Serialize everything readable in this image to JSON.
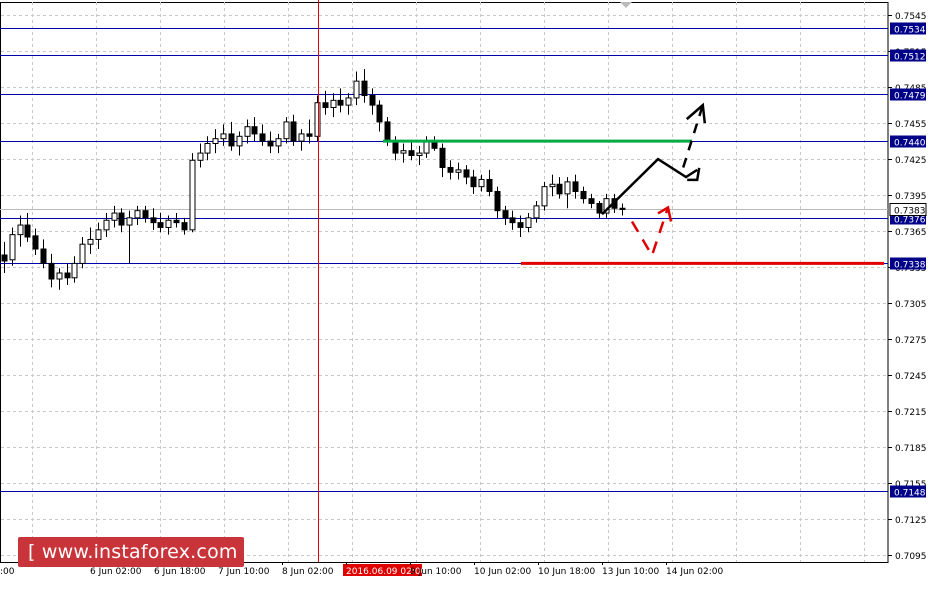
{
  "chart_data": {
    "type": "candlestick",
    "symbol_context": "Forex price chart",
    "price_axis": {
      "ylim": [
        0.7095,
        0.756
      ],
      "tick_labels": [
        "0.7545",
        "0.7515",
        "0.7485",
        "0.7455",
        "0.7425",
        "0.7395",
        "0.7365",
        "0.7335",
        "0.7305",
        "0.7275",
        "0.7245",
        "0.7215",
        "0.7185",
        "0.7155",
        "0.7125",
        "0.7095"
      ],
      "current_price": "0.7383"
    },
    "time_axis": {
      "labels": [
        ":00",
        "6 Jun 02:00",
        "6 Jun 18:00",
        "7 Jun 10:00",
        "8 Jun 02:00",
        "2016.06.09 02:00",
        "9 Jun 10:00",
        "10 Jun 02:00",
        "10 Jun 18:00",
        "13 Jun 10:00",
        "14 Jun 02:00"
      ],
      "highlighted_label": "2016.06.09 02:00"
    },
    "levels": [
      {
        "label": "0.7534",
        "value": 0.7534
      },
      {
        "label": "0.7512",
        "value": 0.7512
      },
      {
        "label": "0.7479",
        "value": 0.7479
      },
      {
        "label": "0.7440",
        "value": 0.744
      },
      {
        "label": "0.7376",
        "value": 0.7376
      },
      {
        "label": "0.7338",
        "value": 0.7338
      },
      {
        "label": "0.7148",
        "value": 0.7148
      }
    ],
    "colors": {
      "level_line": "#0000aa",
      "level_label_bg": "#000088",
      "crosshair": "#e00000",
      "support": "#e00000",
      "resistance": "#00aa44",
      "forecast_up": "#000000",
      "forecast_alt": "#e00000",
      "grid": "#c8c8c8",
      "candle": "#000000"
    },
    "support_level": 0.7338,
    "resistance_level": 0.744,
    "candles": [
      [
        0.7345,
        0.7356,
        0.733,
        0.734
      ],
      [
        0.7341,
        0.7368,
        0.7336,
        0.7362
      ],
      [
        0.7362,
        0.7378,
        0.7352,
        0.737
      ],
      [
        0.737,
        0.738,
        0.7356,
        0.736
      ],
      [
        0.7361,
        0.7367,
        0.7345,
        0.735
      ],
      [
        0.735,
        0.7358,
        0.7334,
        0.7338
      ],
      [
        0.7338,
        0.7346,
        0.7318,
        0.7325
      ],
      [
        0.7325,
        0.7334,
        0.7316,
        0.733
      ],
      [
        0.733,
        0.7338,
        0.732,
        0.7326
      ],
      [
        0.7326,
        0.7344,
        0.7322,
        0.7338
      ],
      [
        0.7338,
        0.736,
        0.7334,
        0.7354
      ],
      [
        0.7354,
        0.7368,
        0.7346,
        0.7358
      ],
      [
        0.7358,
        0.7372,
        0.735,
        0.7366
      ],
      [
        0.7366,
        0.738,
        0.736,
        0.7374
      ],
      [
        0.7374,
        0.7386,
        0.7368,
        0.738
      ],
      [
        0.738,
        0.7384,
        0.7364,
        0.737
      ],
      [
        0.737,
        0.7382,
        0.7338,
        0.7376
      ],
      [
        0.7376,
        0.7386,
        0.737,
        0.7382
      ],
      [
        0.7382,
        0.7386,
        0.7372,
        0.7376
      ],
      [
        0.7376,
        0.7384,
        0.7366,
        0.7372
      ],
      [
        0.7372,
        0.738,
        0.7364,
        0.7368
      ],
      [
        0.7368,
        0.7378,
        0.7362,
        0.7374
      ],
      [
        0.7374,
        0.738,
        0.7368,
        0.7372
      ],
      [
        0.7372,
        0.7376,
        0.7362,
        0.7366
      ],
      [
        0.7366,
        0.743,
        0.7364,
        0.7424
      ],
      [
        0.7424,
        0.7438,
        0.7418,
        0.743
      ],
      [
        0.743,
        0.7444,
        0.7424,
        0.7438
      ],
      [
        0.7438,
        0.745,
        0.743,
        0.7442
      ],
      [
        0.7442,
        0.7454,
        0.7436,
        0.7446
      ],
      [
        0.7446,
        0.7456,
        0.7432,
        0.7436
      ],
      [
        0.7436,
        0.7448,
        0.7428,
        0.7444
      ],
      [
        0.7444,
        0.7458,
        0.7438,
        0.7452
      ],
      [
        0.7452,
        0.746,
        0.744,
        0.7446
      ],
      [
        0.7446,
        0.7454,
        0.7436,
        0.744
      ],
      [
        0.744,
        0.7448,
        0.743,
        0.7436
      ],
      [
        0.7436,
        0.7446,
        0.743,
        0.7442
      ],
      [
        0.7442,
        0.746,
        0.7438,
        0.7456
      ],
      [
        0.7456,
        0.7462,
        0.7436,
        0.744
      ],
      [
        0.744,
        0.745,
        0.7432,
        0.7446
      ],
      [
        0.7446,
        0.7458,
        0.7438,
        0.7444
      ],
      [
        0.7444,
        0.7478,
        0.744,
        0.7472
      ],
      [
        0.7472,
        0.7482,
        0.7462,
        0.7468
      ],
      [
        0.7468,
        0.748,
        0.746,
        0.7474
      ],
      [
        0.7474,
        0.7484,
        0.7464,
        0.747
      ],
      [
        0.747,
        0.748,
        0.7462,
        0.7476
      ],
      [
        0.7476,
        0.7498,
        0.747,
        0.749
      ],
      [
        0.749,
        0.75,
        0.7472,
        0.7478
      ],
      [
        0.7478,
        0.7484,
        0.7462,
        0.747
      ],
      [
        0.747,
        0.7474,
        0.7448,
        0.7456
      ],
      [
        0.7456,
        0.746,
        0.7436,
        0.744
      ],
      [
        0.744,
        0.7444,
        0.7424,
        0.743
      ],
      [
        0.743,
        0.7438,
        0.7422,
        0.7432
      ],
      [
        0.7432,
        0.744,
        0.7424,
        0.7428
      ],
      [
        0.7428,
        0.7436,
        0.742,
        0.743
      ],
      [
        0.743,
        0.7444,
        0.7426,
        0.744
      ],
      [
        0.744,
        0.7444,
        0.7432,
        0.7434
      ],
      [
        0.7434,
        0.7438,
        0.741,
        0.7418
      ],
      [
        0.7418,
        0.7424,
        0.7408,
        0.7414
      ],
      [
        0.7414,
        0.7422,
        0.7408,
        0.7416
      ],
      [
        0.7416,
        0.742,
        0.7404,
        0.741
      ],
      [
        0.741,
        0.7416,
        0.7396,
        0.7402
      ],
      [
        0.7402,
        0.7412,
        0.7398,
        0.7408
      ],
      [
        0.7408,
        0.7416,
        0.7394,
        0.7398
      ],
      [
        0.7398,
        0.7402,
        0.7376,
        0.7382
      ],
      [
        0.7382,
        0.7386,
        0.737,
        0.7376
      ],
      [
        0.7376,
        0.7382,
        0.7366,
        0.7372
      ],
      [
        0.7372,
        0.7378,
        0.736,
        0.7368
      ],
      [
        0.7368,
        0.738,
        0.7364,
        0.7376
      ],
      [
        0.7376,
        0.739,
        0.7372,
        0.7386
      ],
      [
        0.7386,
        0.7406,
        0.7382,
        0.7402
      ],
      [
        0.7402,
        0.7412,
        0.7394,
        0.7404
      ],
      [
        0.7404,
        0.741,
        0.7392,
        0.7396
      ],
      [
        0.7396,
        0.741,
        0.7384,
        0.7406
      ],
      [
        0.7406,
        0.7412,
        0.7392,
        0.7398
      ],
      [
        0.7398,
        0.7402,
        0.7388,
        0.7392
      ],
      [
        0.7392,
        0.7396,
        0.7384,
        0.7388
      ],
      [
        0.7388,
        0.739,
        0.7376,
        0.738
      ],
      [
        0.738,
        0.7396,
        0.7376,
        0.7392
      ],
      [
        0.7392,
        0.7396,
        0.738,
        0.7384
      ],
      [
        0.7384,
        0.7388,
        0.7378,
        0.7383
      ]
    ],
    "forecast_up_path": [
      [
        0.7379,
        -1
      ],
      [
        0.7425,
        1
      ],
      [
        0.741,
        2
      ],
      [
        0.7416,
        2.4
      ]
    ],
    "forecast_up_extension": [
      [
        0.7418,
        2.9
      ],
      [
        0.747,
        3.6
      ]
    ]
  },
  "watermark": {
    "text": "[  www.instaforex.com ]"
  }
}
